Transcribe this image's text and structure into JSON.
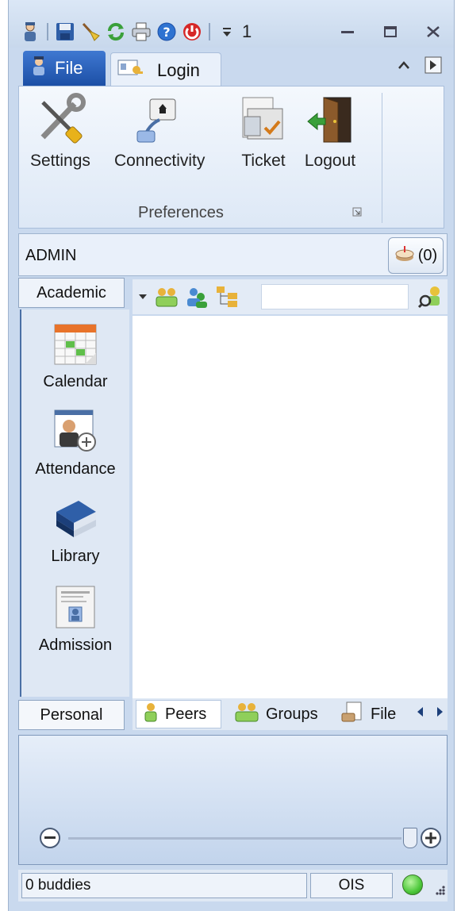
{
  "quick_access": {
    "icons": [
      "user-icon",
      "save-icon",
      "broom-icon",
      "refresh-icon",
      "print-icon",
      "help-icon",
      "power-icon",
      "customize-qat-icon"
    ],
    "number": "1"
  },
  "tabs": {
    "file": "File",
    "login": "Login"
  },
  "ribbon": {
    "buttons": [
      {
        "label": "Settings",
        "icon": "wrench-screwdriver-icon"
      },
      {
        "label": "Connectivity",
        "icon": "network-icon"
      },
      {
        "label": "Ticket",
        "icon": "ticket-icon"
      },
      {
        "label": "Logout",
        "icon": "door-exit-icon"
      }
    ],
    "group_label": "Preferences"
  },
  "admin": {
    "label": "ADMIN",
    "count": "(0)"
  },
  "nav": {
    "header": "Academic",
    "items": [
      {
        "label": "Calendar",
        "icon": "calendar-icon"
      },
      {
        "label": "Attendance",
        "icon": "attendance-icon"
      },
      {
        "label": "Library",
        "icon": "books-icon"
      },
      {
        "label": "Admission",
        "icon": "admission-form-icon"
      }
    ],
    "footer": "Personal"
  },
  "main": {
    "search_value": "",
    "bottom_tabs": [
      {
        "label": "Peers",
        "icon": "person-icon"
      },
      {
        "label": "Groups",
        "icon": "group-icon"
      },
      {
        "label": "File",
        "icon": "file-icon"
      }
    ]
  },
  "status": {
    "buddies": "0 buddies",
    "server": "OIS",
    "presence_color": "#4cc83a"
  },
  "colors": {
    "window_bg": "#c9d9ee",
    "file_tab": "#1c4fa6",
    "accent_border": "#4a6fa5"
  }
}
